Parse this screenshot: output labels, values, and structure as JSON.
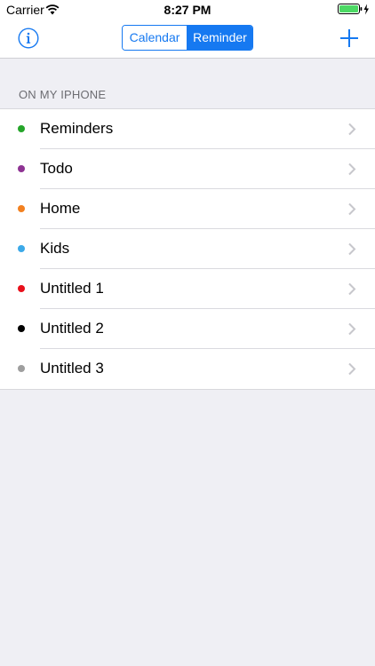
{
  "status_bar": {
    "carrier": "Carrier",
    "time": "8:27 PM",
    "wifi_icon": "wifi-icon",
    "battery_icon": "battery-charging-icon",
    "battery_color": "#4cd964"
  },
  "nav": {
    "info_icon": "info-icon",
    "segments": [
      {
        "label": "Calendar",
        "selected": false
      },
      {
        "label": "Reminder",
        "selected": true
      }
    ],
    "add_icon": "plus-icon",
    "accent_color": "#1679f1"
  },
  "section": {
    "header": "ON MY IPHONE"
  },
  "lists": [
    {
      "name": "Reminders",
      "color": "#25a52a"
    },
    {
      "name": "Todo",
      "color": "#8e3393"
    },
    {
      "name": "Home",
      "color": "#f28020"
    },
    {
      "name": "Kids",
      "color": "#3ca9e8"
    },
    {
      "name": "Untitled 1",
      "color": "#e8101b"
    },
    {
      "name": "Untitled 2",
      "color": "#000000"
    },
    {
      "name": "Untitled 3",
      "color": "#9e9e9e"
    }
  ]
}
